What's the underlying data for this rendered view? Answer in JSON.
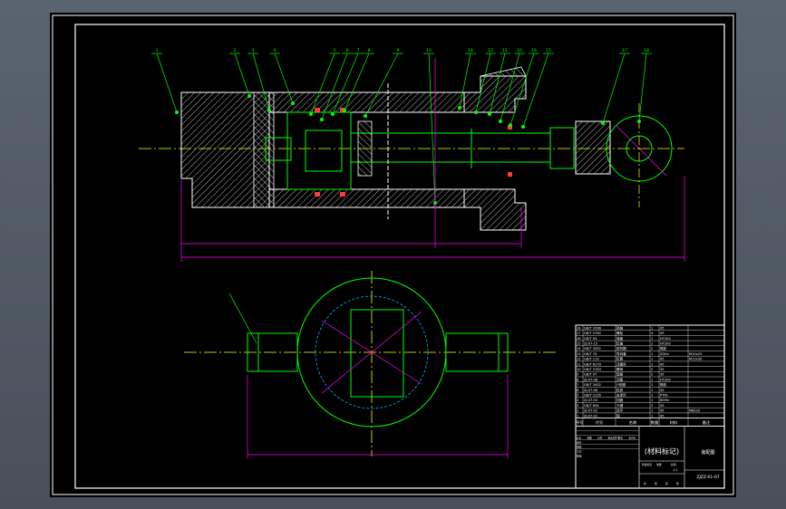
{
  "colors": {
    "background": "#4f5965",
    "sheet": "#000000",
    "outline": "#ffffff",
    "part_outline": "#00ff00",
    "dimension": "#ff00ff",
    "centerline": "#ffff00",
    "hatch": "#ffffff",
    "seal": "#ff3b3b",
    "hidden_circle": "#00b4ff"
  },
  "balloons": [
    "1",
    "2",
    "3",
    "4",
    "5",
    "6",
    "7",
    "8",
    "9",
    "13",
    "14",
    "12",
    "11",
    "10",
    "16",
    "15",
    "17",
    "18"
  ],
  "title_block": {
    "material_label": "(材料标记)",
    "drawing_title": "装配图",
    "drawing_number": "ZJZZ-01-07",
    "header_cols": [
      "序号",
      "代号",
      "名称",
      "数量",
      "材料",
      "备注"
    ],
    "parts_rows": [
      {
        "no": "18",
        "code": "GB/T 1096",
        "name": "销轴",
        "qty": "1",
        "mat": "45",
        "note": ""
      },
      {
        "no": "17",
        "code": "GB/T 5782",
        "name": "螺栓",
        "qty": "4",
        "mat": "45",
        "note": ""
      },
      {
        "no": "16",
        "code": "GB/T 93",
        "name": "端盖",
        "qty": "1",
        "mat": "HT200",
        "note": ""
      },
      {
        "no": "15",
        "code": "ZJ-07-15",
        "name": "缸盖",
        "qty": "1",
        "mat": "HT200",
        "note": ""
      },
      {
        "no": "14",
        "code": "GB/T 3452",
        "name": "密封圈",
        "qty": "2",
        "mat": "橡胶",
        "note": ""
      },
      {
        "no": "13",
        "code": "GB/T 70",
        "name": "导向套",
        "qty": "1",
        "mat": "ZQSn",
        "note": "M10x25"
      },
      {
        "no": "12",
        "code": "GB/T 119",
        "name": "缸筒",
        "qty": "1",
        "mat": "45",
        "note": "M12x30"
      },
      {
        "no": "11",
        "code": "GB/T 6170",
        "name": "活塞杆",
        "qty": "1",
        "mat": "45",
        "note": ""
      },
      {
        "no": "10",
        "code": "GB/T 5783",
        "name": "螺母",
        "qty": "2",
        "mat": "35",
        "note": ""
      },
      {
        "no": "9",
        "code": "GB/T 97",
        "name": "垫圈",
        "qty": "2",
        "mat": "35",
        "note": ""
      },
      {
        "no": "8",
        "code": "ZJ-07-08",
        "name": "活塞",
        "qty": "1",
        "mat": "HT200",
        "note": ""
      },
      {
        "no": "7",
        "code": "GB/T 3452",
        "name": "O形圈",
        "qty": "2",
        "mat": "橡胶",
        "note": ""
      },
      {
        "no": "6",
        "code": "ZJ-07-06",
        "name": "缸底",
        "qty": "1",
        "mat": "45",
        "note": ""
      },
      {
        "no": "5",
        "code": "GB/T 1235",
        "name": "支承环",
        "qty": "1",
        "mat": "PTFE",
        "note": ""
      },
      {
        "no": "4",
        "code": "ZJ-07-04",
        "name": "挡圈",
        "qty": "1",
        "mat": "65Mn",
        "note": ""
      },
      {
        "no": "3",
        "code": "GB/T 894",
        "name": "卡键",
        "qty": "2",
        "mat": "45",
        "note": ""
      },
      {
        "no": "2",
        "code": "ZJ-07-02",
        "name": "耳环",
        "qty": "1",
        "mat": "45",
        "note": "M8x20"
      },
      {
        "no": "1",
        "code": "ZJ-07-01",
        "name": "销",
        "qty": "1",
        "mat": "45",
        "note": ""
      }
    ],
    "sign_labels": [
      "标记",
      "处数",
      "分区",
      "更改文件号",
      "签名",
      "年月日"
    ],
    "role_labels": [
      "设计",
      "审核",
      "工艺",
      "批准"
    ],
    "stage_labels": [
      "阶段标记",
      "重量",
      "比例"
    ],
    "scale": "1:1",
    "sheet_labels": [
      "共",
      "张",
      "第",
      "张"
    ]
  }
}
